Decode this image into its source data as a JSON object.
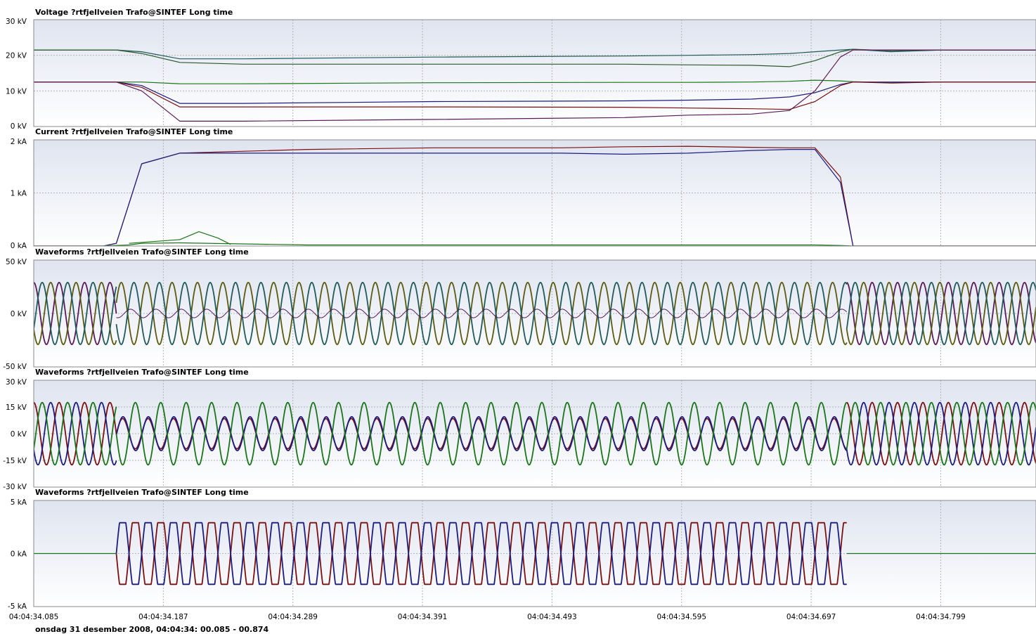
{
  "footer": "onsdag 31 desember 2008, 04:04:34: 00.085 - 00.874",
  "colors": {
    "dark_red": "#7b1010",
    "navy": "#1c1c80",
    "green": "#197519",
    "purple": "#5a1a5a",
    "olive": "#5a5a10",
    "teal": "#1f5a5a",
    "dark_green": "#2a5a2a",
    "grid": "#b4b4b4",
    "panel_bg_top": "#e4e8f2",
    "panel_bg_bottom": "#ffffff"
  },
  "chart_data": [
    {
      "type": "line",
      "title": "Voltage ?rtfjellveien Trafo@SINTEF Long time",
      "ylim": [
        0,
        30
      ],
      "yticks": [
        "30 kV",
        "20 kV",
        "10 kV",
        "0 kV"
      ],
      "ytick_values": [
        30,
        20,
        10,
        0
      ],
      "grid": "on",
      "x": [
        0.085,
        0.15,
        0.17,
        0.2,
        0.25,
        0.4,
        0.55,
        0.6,
        0.65,
        0.68,
        0.7,
        0.72,
        0.73,
        0.76,
        0.8,
        0.874
      ],
      "series": [
        {
          "color": "#1f5a5a",
          "values": [
            21.5,
            21.5,
            21.0,
            19.0,
            19.0,
            19.5,
            19.8,
            20.0,
            20.2,
            20.5,
            21.0,
            21.5,
            21.7,
            21.0,
            21.5,
            21.5
          ]
        },
        {
          "color": "#2a5a2a",
          "values": [
            21.5,
            21.5,
            20.5,
            18.0,
            17.5,
            17.5,
            17.5,
            17.3,
            17.2,
            16.8,
            18.5,
            21.0,
            21.7,
            21.3,
            21.5,
            21.5
          ]
        },
        {
          "color": "#197519",
          "values": [
            12.5,
            12.5,
            12.5,
            12.0,
            12.0,
            12.3,
            12.4,
            12.4,
            12.5,
            12.7,
            13.0,
            12.8,
            12.6,
            12.3,
            12.5,
            12.5
          ]
        },
        {
          "color": "#1c1c80",
          "values": [
            12.5,
            12.5,
            11.5,
            6.5,
            6.5,
            7.0,
            7.2,
            7.4,
            7.7,
            8.3,
            9.5,
            11.8,
            12.5,
            12.5,
            12.5,
            12.5
          ]
        },
        {
          "color": "#7b1010",
          "values": [
            12.5,
            12.5,
            11.0,
            5.5,
            5.5,
            5.5,
            5.4,
            5.2,
            5.0,
            4.8,
            7.0,
            11.5,
            12.5,
            12.2,
            12.5,
            12.5
          ]
        },
        {
          "color": "#5a1a5a",
          "values": [
            12.5,
            12.5,
            10.0,
            1.5,
            1.5,
            2.0,
            2.5,
            3.2,
            3.5,
            4.5,
            10.0,
            19.5,
            21.5,
            21.5,
            21.5,
            21.5
          ]
        }
      ]
    },
    {
      "type": "line",
      "title": "Current ?rtfjellveien Trafo@SINTEF Long time",
      "ylim": [
        0,
        2
      ],
      "yticks": [
        "2 kA",
        "1 kA",
        "0 kA"
      ],
      "ytick_values": [
        2,
        1,
        0
      ],
      "grid": "on",
      "x": [
        0.085,
        0.14,
        0.15,
        0.16,
        0.17,
        0.2,
        0.3,
        0.4,
        0.5,
        0.55,
        0.6,
        0.65,
        0.68,
        0.7,
        0.72,
        0.73,
        0.8,
        0.874
      ],
      "series": [
        {
          "color": "#7b1010",
          "values": [
            0,
            0,
            0.05,
            0.8,
            1.55,
            1.75,
            1.82,
            1.85,
            1.85,
            1.87,
            1.88,
            1.86,
            1.85,
            1.85,
            1.3,
            0,
            0,
            0
          ]
        },
        {
          "color": "#1c1c80",
          "values": [
            0,
            0,
            0.05,
            0.8,
            1.55,
            1.75,
            1.75,
            1.75,
            1.75,
            1.73,
            1.75,
            1.8,
            1.82,
            1.82,
            1.2,
            0,
            0,
            0
          ]
        },
        {
          "color": "#197519",
          "values": [
            0,
            0,
            0.01,
            0.02,
            0.05,
            0.06,
            0.02,
            0.02,
            0.02,
            0.02,
            0.02,
            0.02,
            0.02,
            0.02,
            0.01,
            0,
            0,
            0
          ]
        }
      ],
      "bumps": [
        {
          "color": "#197519",
          "x": [
            0.16,
            0.2,
            0.215,
            0.23,
            0.24
          ],
          "values": [
            0.05,
            0.12,
            0.27,
            0.15,
            0.03
          ]
        }
      ]
    },
    {
      "type": "line",
      "title": "Waveforms ?rtfjellveien Trafo@SINTEF Long time",
      "ylim": [
        -50,
        50
      ],
      "yticks": [
        "50 kV",
        "0 kV",
        "-50 kV"
      ],
      "ytick_values": [
        50,
        0,
        -50
      ],
      "grid": "on",
      "frequency_hz": 50,
      "segments": [
        {
          "x_range": [
            0.085,
            0.15
          ],
          "amplitude": 29,
          "phases_deg": [
            0,
            120,
            240
          ],
          "colors": [
            "#5a1a5a",
            "#5a5a10",
            "#1f5a5a"
          ]
        },
        {
          "x_range": [
            0.15,
            0.725
          ],
          "amplitude": 29,
          "phases_deg": [
            200,
            20
          ],
          "colors": [
            "#5a5a10",
            "#1f5a5a"
          ],
          "residual_amplitude": 4,
          "residual_color": "#5a1a5a"
        },
        {
          "x_range": [
            0.725,
            0.874
          ],
          "amplitude": 29,
          "phases_deg": [
            0,
            120,
            240
          ],
          "colors": [
            "#5a1a5a",
            "#5a5a10",
            "#1f5a5a"
          ]
        }
      ]
    },
    {
      "type": "line",
      "title": "Waveforms ?rtfjellveien Trafo@SINTEF Long time",
      "ylim": [
        -30,
        30
      ],
      "yticks": [
        "30 kV",
        "15 kV",
        "0 kV",
        "-15 kV",
        "-30 kV"
      ],
      "ytick_values": [
        30,
        15,
        0,
        -15,
        -30
      ],
      "grid": "on",
      "frequency_hz": 50,
      "segments": [
        {
          "x_range": [
            0.085,
            0.15
          ],
          "amplitude": 17.5,
          "phases_deg": [
            0,
            120,
            240
          ],
          "colors": [
            "#7b1010",
            "#1c1c80",
            "#197519"
          ]
        },
        {
          "x_range": [
            0.15,
            0.725
          ],
          "amplitude_by_series": [
            8.5,
            9.5,
            17.5
          ],
          "phases_deg": [
            180,
            175,
            0
          ],
          "colors": [
            "#7b1010",
            "#1c1c80",
            "#197519"
          ]
        },
        {
          "x_range": [
            0.725,
            0.874
          ],
          "amplitude": 17.5,
          "phases_deg": [
            0,
            120,
            240
          ],
          "colors": [
            "#7b1010",
            "#1c1c80",
            "#197519"
          ]
        }
      ]
    },
    {
      "type": "line",
      "title": "Waveforms ?rtfjellveien Trafo@SINTEF Long time",
      "ylim": [
        -5,
        5
      ],
      "yticks": [
        "5 kA",
        "0 kA",
        "-5 kA"
      ],
      "ytick_values": [
        5,
        0,
        -5
      ],
      "grid": "on",
      "frequency_hz": 50,
      "segments": [
        {
          "x_range": [
            0.15,
            0.725
          ],
          "amplitude": 2.9,
          "phases_deg": [
            0,
            180
          ],
          "colors": [
            "#7b1010",
            "#1c1c80"
          ],
          "clipped": true
        }
      ]
    }
  ],
  "x_axis": {
    "ticks": [
      "04:04:34.085",
      "04:04:34.187",
      "04:04:34.289",
      "04:04:34.391",
      "04:04:34.493",
      "04:04:34.595",
      "04:04:34.697",
      "04:04:34.799"
    ],
    "tick_values": [
      0.085,
      0.187,
      0.289,
      0.391,
      0.493,
      0.595,
      0.697,
      0.799
    ],
    "range": [
      0.085,
      0.874
    ]
  }
}
